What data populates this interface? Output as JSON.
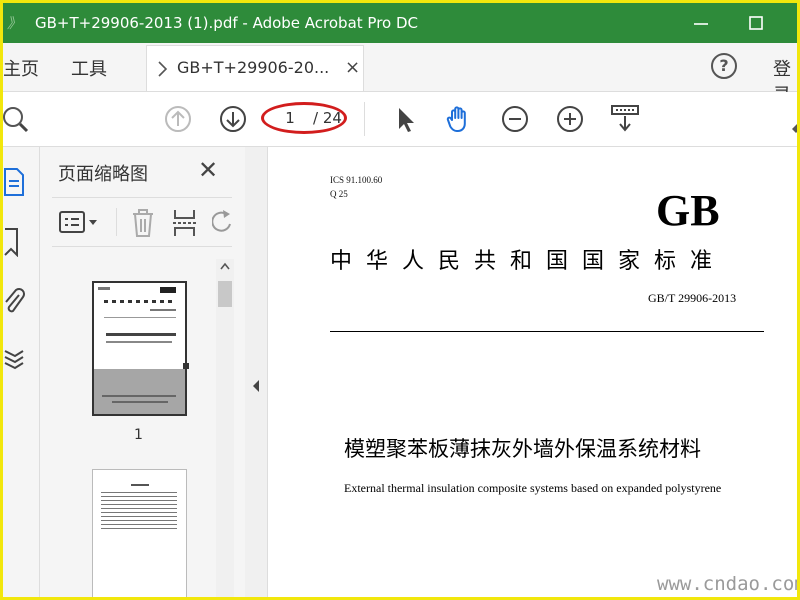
{
  "window": {
    "title": "GB+T+29906-2013 (1).pdf - Adobe Acrobat Pro DC",
    "overlay_logo": "》"
  },
  "menubar": {
    "home": "主页",
    "tools": "工具",
    "doc_tab": "GB+T+29906-20...",
    "doc_tab_close": "×",
    "help": "?",
    "login": "登录"
  },
  "toolbar": {
    "current_page": "1",
    "total_pages": "/ 24",
    "highlight_color": "#d21d1d"
  },
  "panel": {
    "title": "页面缩略图",
    "close": "✕",
    "thumbnails": [
      {
        "label": "1"
      },
      {
        "label": ""
      }
    ]
  },
  "document": {
    "ics": "ICS 91.100.60",
    "classification": "Q 25",
    "logo": "GB",
    "standard_name": "中华人民共和国国家标准",
    "code": "GB/T 29906-2013",
    "title_cn": "模塑聚苯板薄抹灰外墙外保温系统材料",
    "title_en": "External thermal insulation composite systems based on expanded polystyrene"
  },
  "watermark": "www.cndao.com",
  "colors": {
    "titlebar": "#2e8b3a",
    "frame_border": "#f2e70c",
    "hand_tool_active": "#1e6fd9"
  }
}
